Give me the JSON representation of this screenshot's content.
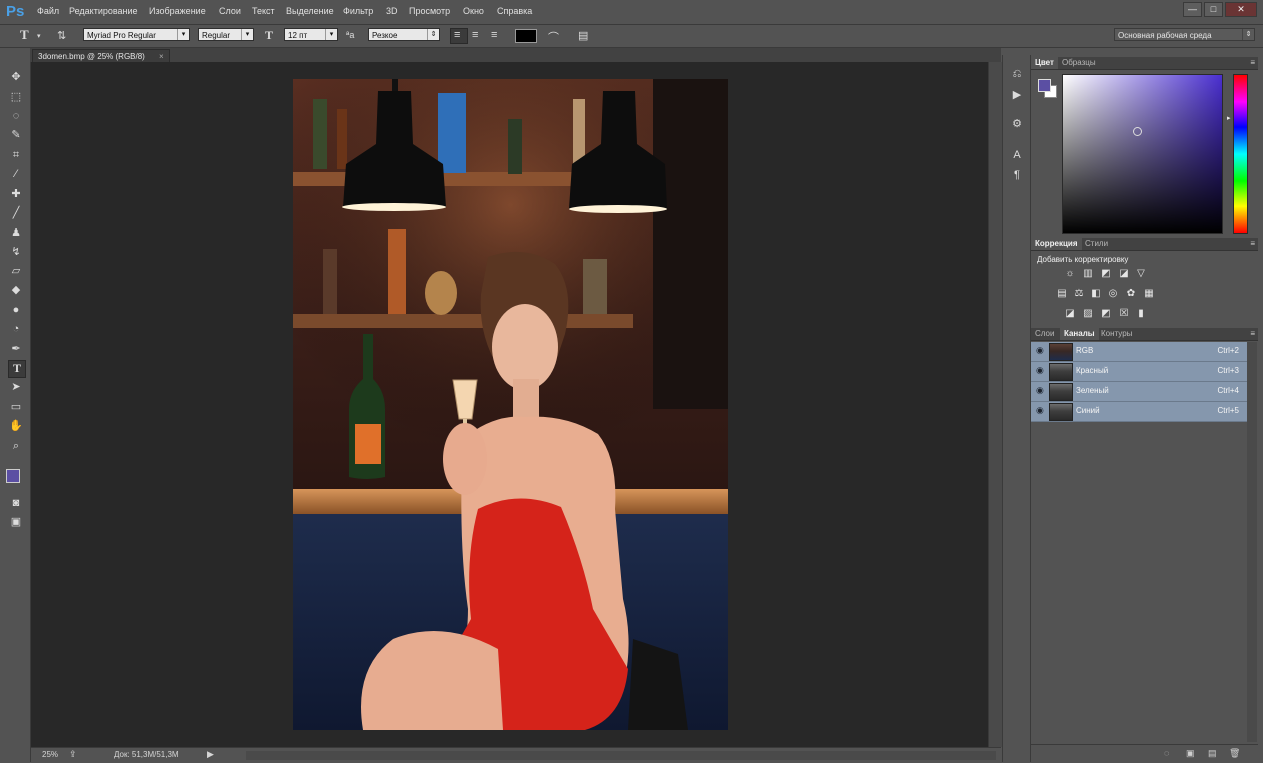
{
  "app": {
    "logo": "Ps"
  },
  "menu": [
    "Файл",
    "Редактирование",
    "Изображение",
    "Слои",
    "Текст",
    "Выделение",
    "Фильтр",
    "3D",
    "Просмотр",
    "Окно",
    "Справка"
  ],
  "window_controls": {
    "minimize": "—",
    "maximize": "□",
    "close": "✕"
  },
  "options": {
    "tool_glyph": "T",
    "font_family": "Myriad Pro Regular",
    "font_style": "Regular",
    "font_size": "12 пт",
    "aa_label": "ªa",
    "antialias": "Резкое",
    "text_color": "#000000",
    "workspace": "Основная рабочая среда"
  },
  "document": {
    "tab_title": "3domen.bmp @ 25% (RGB/8)",
    "close": "×"
  },
  "status": {
    "zoom": "25%",
    "doc_info": "Док: 51,3M/51,3M"
  },
  "colors": {
    "foreground": "#5b4fa3",
    "background": "#ffffff",
    "accent": "#4aa0e6",
    "selection": "#8597ad"
  },
  "panels": {
    "color": {
      "tabs": [
        "Цвет",
        "Образцы"
      ],
      "active": 0,
      "hue_color": "#4a2fd0"
    },
    "adjustments": {
      "tabs": [
        "Коррекция",
        "Стили"
      ],
      "active": 0,
      "heading": "Добавить корректировку"
    },
    "layers": {
      "tabs": [
        "Слои",
        "Каналы",
        "Контуры"
      ],
      "active": 1,
      "channels": [
        {
          "name": "RGB",
          "shortcut": "Ctrl+2"
        },
        {
          "name": "Красный",
          "shortcut": "Ctrl+3"
        },
        {
          "name": "Зеленый",
          "shortcut": "Ctrl+4"
        },
        {
          "name": "Синий",
          "shortcut": "Ctrl+5"
        }
      ]
    }
  }
}
